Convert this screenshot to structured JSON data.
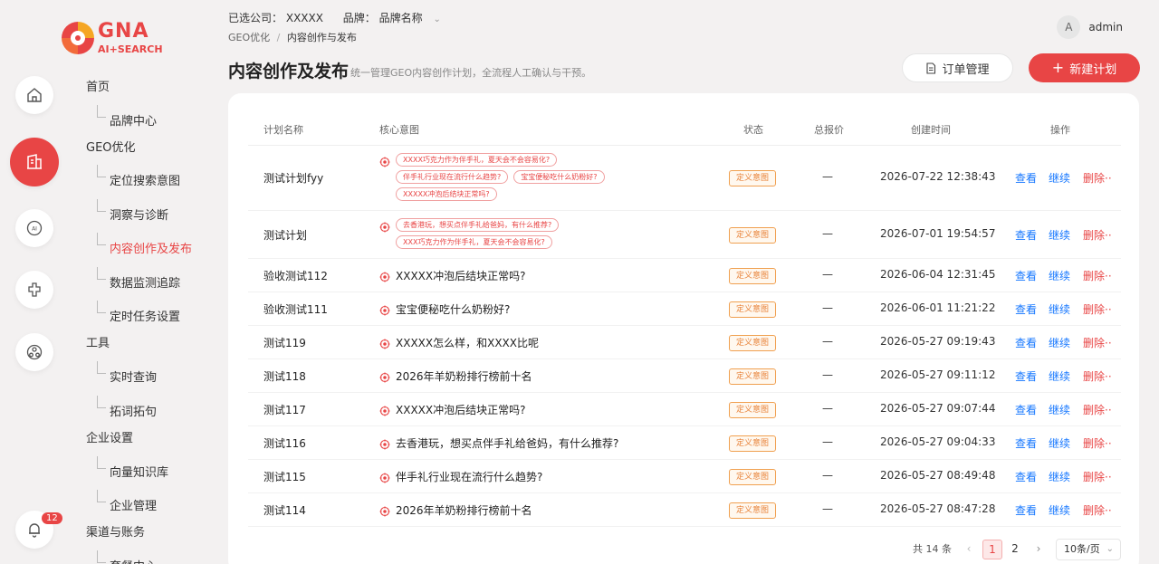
{
  "logo": {
    "brand": "GNA",
    "tagline": "AI+SEARCH"
  },
  "header": {
    "company_label": "已选公司：",
    "company_value": "XXXXX",
    "brand_label": "品牌：",
    "brand_value": "品牌名称",
    "breadcrumb": {
      "parent": "GEO优化",
      "separator": "/",
      "current": "内容创作与发布"
    },
    "avatar_letter": "A",
    "username": "admin"
  },
  "rail": {
    "notification_count": "12"
  },
  "nav": {
    "groups": [
      {
        "label": "首页"
      },
      {
        "label": "GEO优化"
      },
      {
        "label": "工具"
      },
      {
        "label": "企业设置"
      },
      {
        "label": "渠道与账务"
      }
    ],
    "items": [
      {
        "label": "品牌中心"
      },
      {
        "label": "定位搜索意图"
      },
      {
        "label": "洞察与诊断"
      },
      {
        "label": "内容创作及发布"
      },
      {
        "label": "数据监测追踪"
      },
      {
        "label": "定时任务设置"
      },
      {
        "label": "实时查询"
      },
      {
        "label": "拓词拓句"
      },
      {
        "label": "向量知识库"
      },
      {
        "label": "企业管理"
      },
      {
        "label": "套餐中心"
      }
    ]
  },
  "page": {
    "title": "内容创作及发布",
    "description": "统一管理GEO内容创作计划，全流程人工确认与干预。",
    "order_button": "订单管理",
    "new_button": "新建计划"
  },
  "table": {
    "headers": {
      "name": "计划名称",
      "intent": "核心意图",
      "status": "状态",
      "price": "总报价",
      "created": "创建时间",
      "actions": "操作"
    },
    "action_labels": {
      "view": "查看",
      "continue": "继续",
      "delete": "删除··"
    },
    "rows": [
      {
        "name": "测试计划fyy",
        "tags": [
          "XXXX巧克力作为伴手礼，夏天会不会容易化?",
          "伴手礼行业现在流行什么趋势?",
          "宝宝便秘吃什么奶粉好?",
          "XXXXX冲泡后结块正常吗?"
        ],
        "status": "定义意图",
        "price": "—",
        "created": "2026-07-22 12:38:43"
      },
      {
        "name": "测试计划",
        "tags": [
          "去香港玩，想买点伴手礼给爸妈，有什么推荐?",
          "XXX巧克力作为伴手礼，夏天会不会容易化?"
        ],
        "status": "定义意图",
        "price": "—",
        "created": "2026-07-01 19:54:57"
      },
      {
        "name": "验收测试112",
        "intent": "XXXXX冲泡后结块正常吗?",
        "status": "定义意图",
        "price": "—",
        "created": "2026-06-04 12:31:45"
      },
      {
        "name": "验收测试111",
        "intent": "宝宝便秘吃什么奶粉好?",
        "status": "定义意图",
        "price": "—",
        "created": "2026-06-01 11:21:22"
      },
      {
        "name": "测试119",
        "intent": "XXXXX怎么样，和XXXX比呢",
        "status": "定义意图",
        "price": "—",
        "created": "2026-05-27 09:19:43"
      },
      {
        "name": "测试118",
        "intent": "2026年羊奶粉排行榜前十名",
        "status": "定义意图",
        "price": "—",
        "created": "2026-05-27 09:11:12"
      },
      {
        "name": "测试117",
        "intent": "XXXXX冲泡后结块正常吗?",
        "status": "定义意图",
        "price": "—",
        "created": "2026-05-27 09:07:44"
      },
      {
        "name": "测试116",
        "intent": "去香港玩，想买点伴手礼给爸妈，有什么推荐?",
        "status": "定义意图",
        "price": "—",
        "created": "2026-05-27 09:04:33"
      },
      {
        "name": "测试115",
        "intent": "伴手礼行业现在流行什么趋势?",
        "status": "定义意图",
        "price": "—",
        "created": "2026-05-27 08:49:48"
      },
      {
        "name": "测试114",
        "intent": "2026年羊奶粉排行榜前十名",
        "status": "定义意图",
        "price": "—",
        "created": "2026-05-27 08:47:28"
      }
    ]
  },
  "pagination": {
    "total": "共 14 条",
    "prev": "‹",
    "pages": [
      "1",
      "2"
    ],
    "current_page": 1,
    "next": "›",
    "page_size": "10条/页"
  },
  "colors": {
    "accent": "#e84545",
    "link": "#1677ff",
    "status": "#e8833a"
  }
}
